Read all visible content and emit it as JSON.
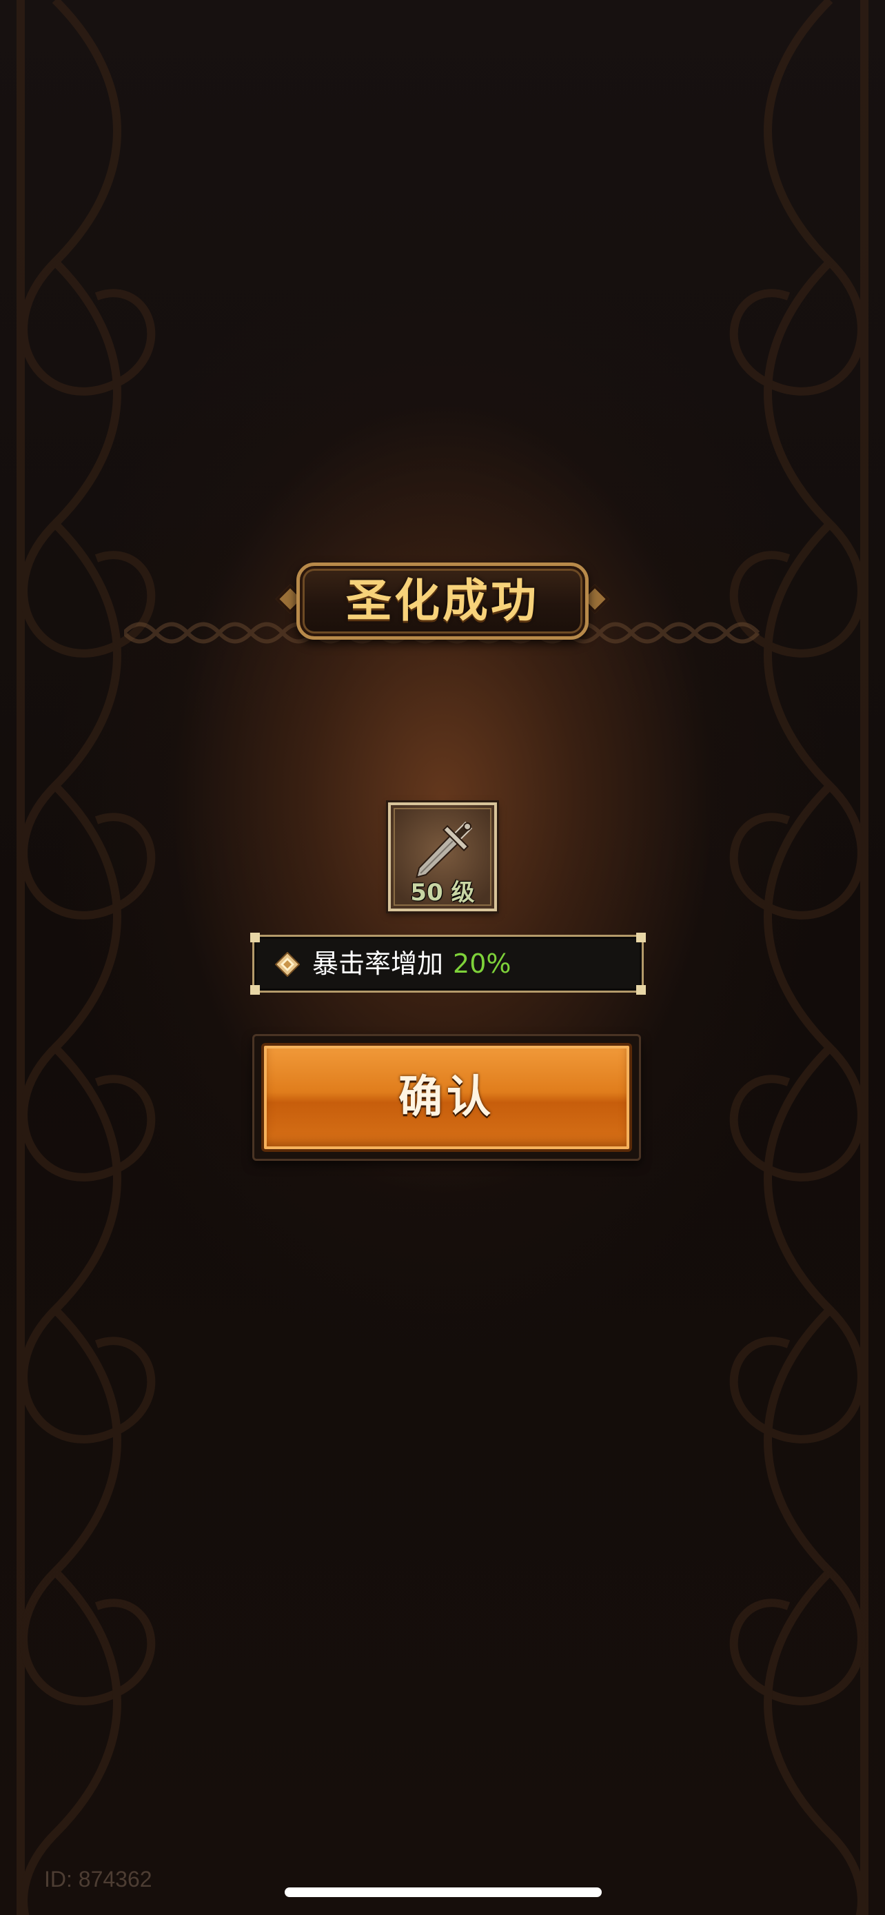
{
  "dialog": {
    "title": "圣化成功",
    "item": {
      "icon": "sword-icon",
      "level_label": "50 级"
    },
    "attribute": {
      "icon": "diamond-sparkle-icon",
      "label": "暴击率增加",
      "value": "20%"
    },
    "confirm_label": "确认"
  },
  "footer": {
    "player_id": "ID: 874362"
  },
  "colors": {
    "title_gold": "#f7d27a",
    "button_orange": "#e07d1c",
    "value_green": "#7ed23a",
    "background_brown": "#140d0a"
  }
}
